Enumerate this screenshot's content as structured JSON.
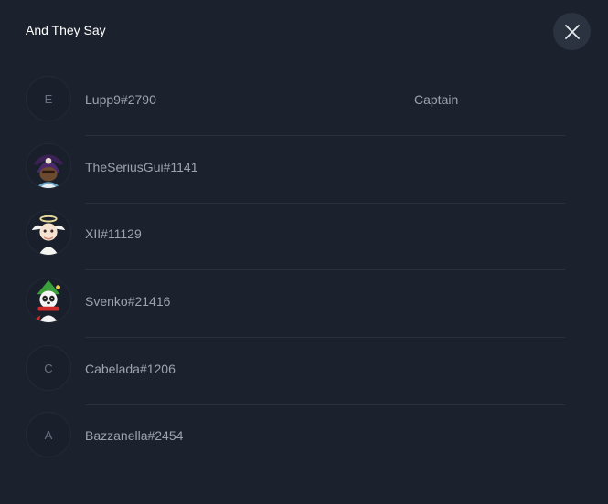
{
  "modal": {
    "title": "And They Say",
    "close_icon": "close-icon"
  },
  "members": [
    {
      "name": "Lupp9#2790",
      "role": "Captain",
      "avatar_letter": "E",
      "avatar_icon": null
    },
    {
      "name": "TheSeriusGui#1141",
      "role": "",
      "avatar_letter": "",
      "avatar_icon": "pirate-avatar-icon"
    },
    {
      "name": "XII#11129",
      "role": "",
      "avatar_letter": "",
      "avatar_icon": "angel-avatar-icon"
    },
    {
      "name": "Svenko#21416",
      "role": "",
      "avatar_letter": "",
      "avatar_icon": "panda-elf-avatar-icon"
    },
    {
      "name": "Cabelada#1206",
      "role": "",
      "avatar_letter": "C",
      "avatar_icon": null
    },
    {
      "name": "Bazzanella#2454",
      "role": "",
      "avatar_letter": "A",
      "avatar_icon": null
    }
  ],
  "colors": {
    "background": "#1c222d",
    "text_primary": "#ffffff",
    "text_secondary": "#9ba3af",
    "divider": "#2a313d"
  }
}
